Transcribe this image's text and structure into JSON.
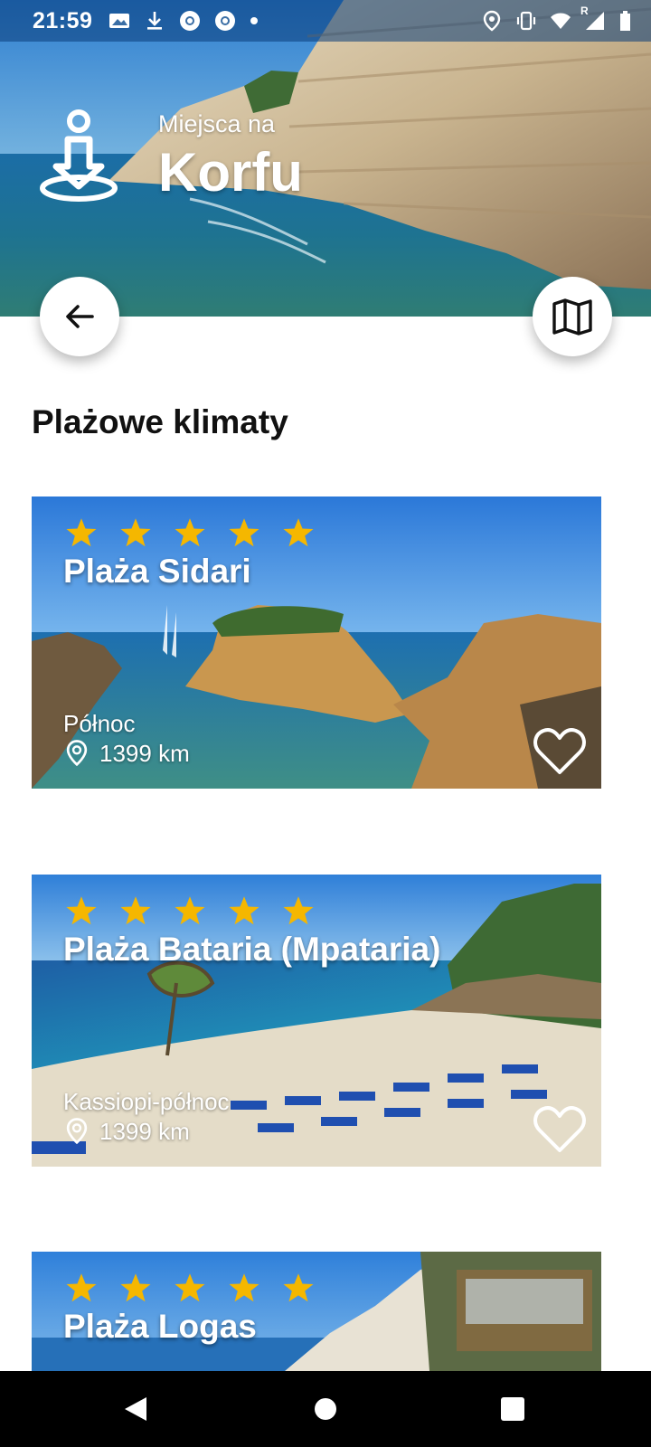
{
  "status_bar": {
    "time": "21:59",
    "left_icons": [
      "gallery-icon",
      "download-icon",
      "chrome-icon",
      "chrome-icon",
      "dot-icon"
    ],
    "right_icons": [
      "location-icon",
      "vibrate-icon",
      "wifi-icon",
      "signal-icon",
      "battery-icon"
    ],
    "network_badge": "R"
  },
  "header": {
    "subtitle": "Miejsca na",
    "title": "Korfu",
    "logo_icon": "person-pin-icon"
  },
  "buttons": {
    "back_icon": "arrow-left-icon",
    "map_icon": "map-icon"
  },
  "section": {
    "title": "Plażowe klimaty"
  },
  "places": [
    {
      "name": "Plaża Sidari",
      "region": "Północ",
      "distance": "1399 km",
      "rating": 5
    },
    {
      "name": "Plaża Bataria (Mpataria)",
      "region": "Kassiopi-północ",
      "distance": "1399 km",
      "rating": 5
    },
    {
      "name": "Plaża Logas",
      "region": "",
      "distance": "",
      "rating": 5
    }
  ],
  "colors": {
    "star": "#f5b700",
    "accent_white": "#ffffff",
    "nav_bar": "#000000"
  },
  "nav": {
    "icons": [
      "back-triangle-icon",
      "home-circle-icon",
      "recents-square-icon"
    ]
  }
}
